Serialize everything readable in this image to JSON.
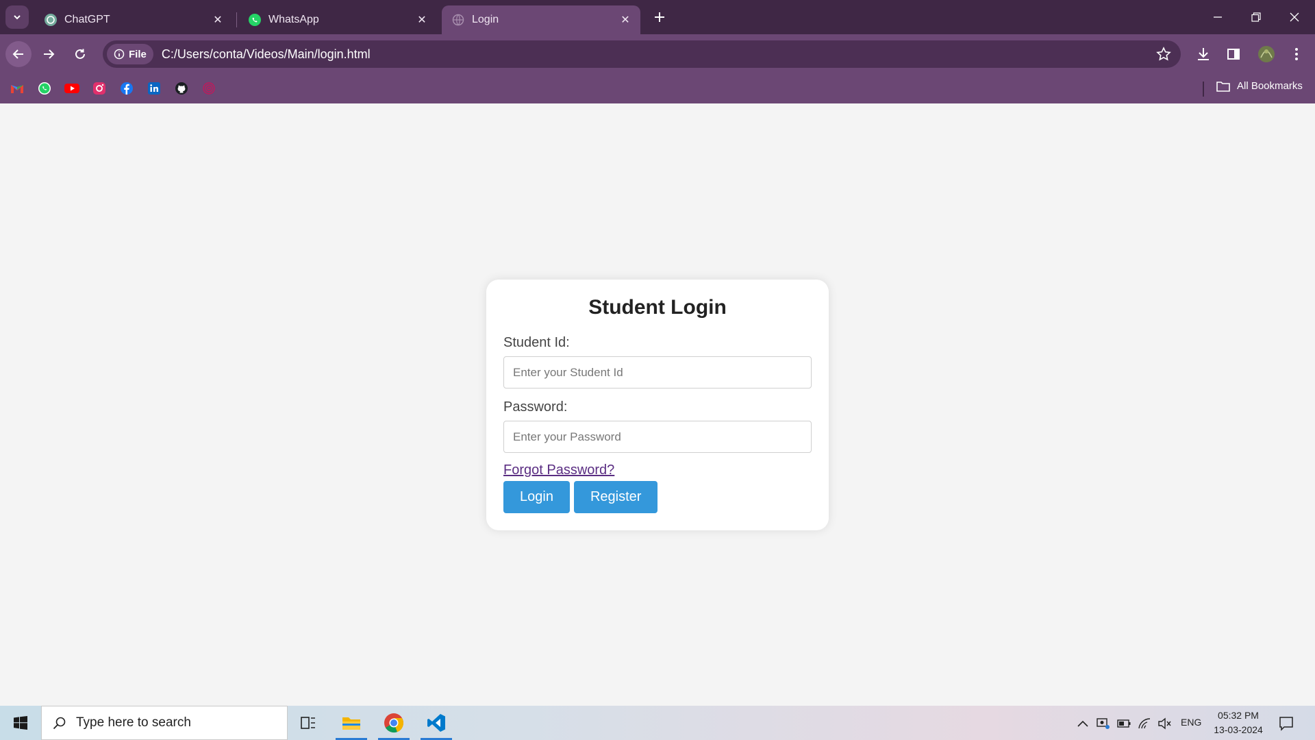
{
  "browser": {
    "tabs": [
      {
        "title": "ChatGPT",
        "icon": "chatgpt-icon",
        "active": false
      },
      {
        "title": "WhatsApp",
        "icon": "whatsapp-icon",
        "active": false
      },
      {
        "title": "Login",
        "icon": "globe-icon",
        "active": true
      }
    ],
    "address": {
      "scheme_chip": "File",
      "url": "C:/Users/conta/Videos/Main/login.html"
    },
    "bookmarks": {
      "icons": [
        "gmail-icon",
        "whatsapp-icon",
        "youtube-icon",
        "instagram-icon",
        "facebook-icon",
        "linkedin-icon",
        "github-icon",
        "fingerprint-icon"
      ],
      "all_label": "All Bookmarks"
    },
    "colors": {
      "frame": "#3f2745",
      "toolbar": "#6b4774",
      "omnibox": "#4c2f54"
    }
  },
  "login": {
    "title": "Student Login",
    "student_id_label": "Student Id:",
    "student_id_placeholder": "Enter your Student Id",
    "password_label": "Password:",
    "password_placeholder": "Enter your Password",
    "forgot_link": "Forgot Password?",
    "login_button": "Login",
    "register_button": "Register",
    "accent_color": "#3498db"
  },
  "taskbar": {
    "search_placeholder": "Type here to search",
    "language": "ENG",
    "time": "05:32 PM",
    "date": "13-03-2024"
  }
}
